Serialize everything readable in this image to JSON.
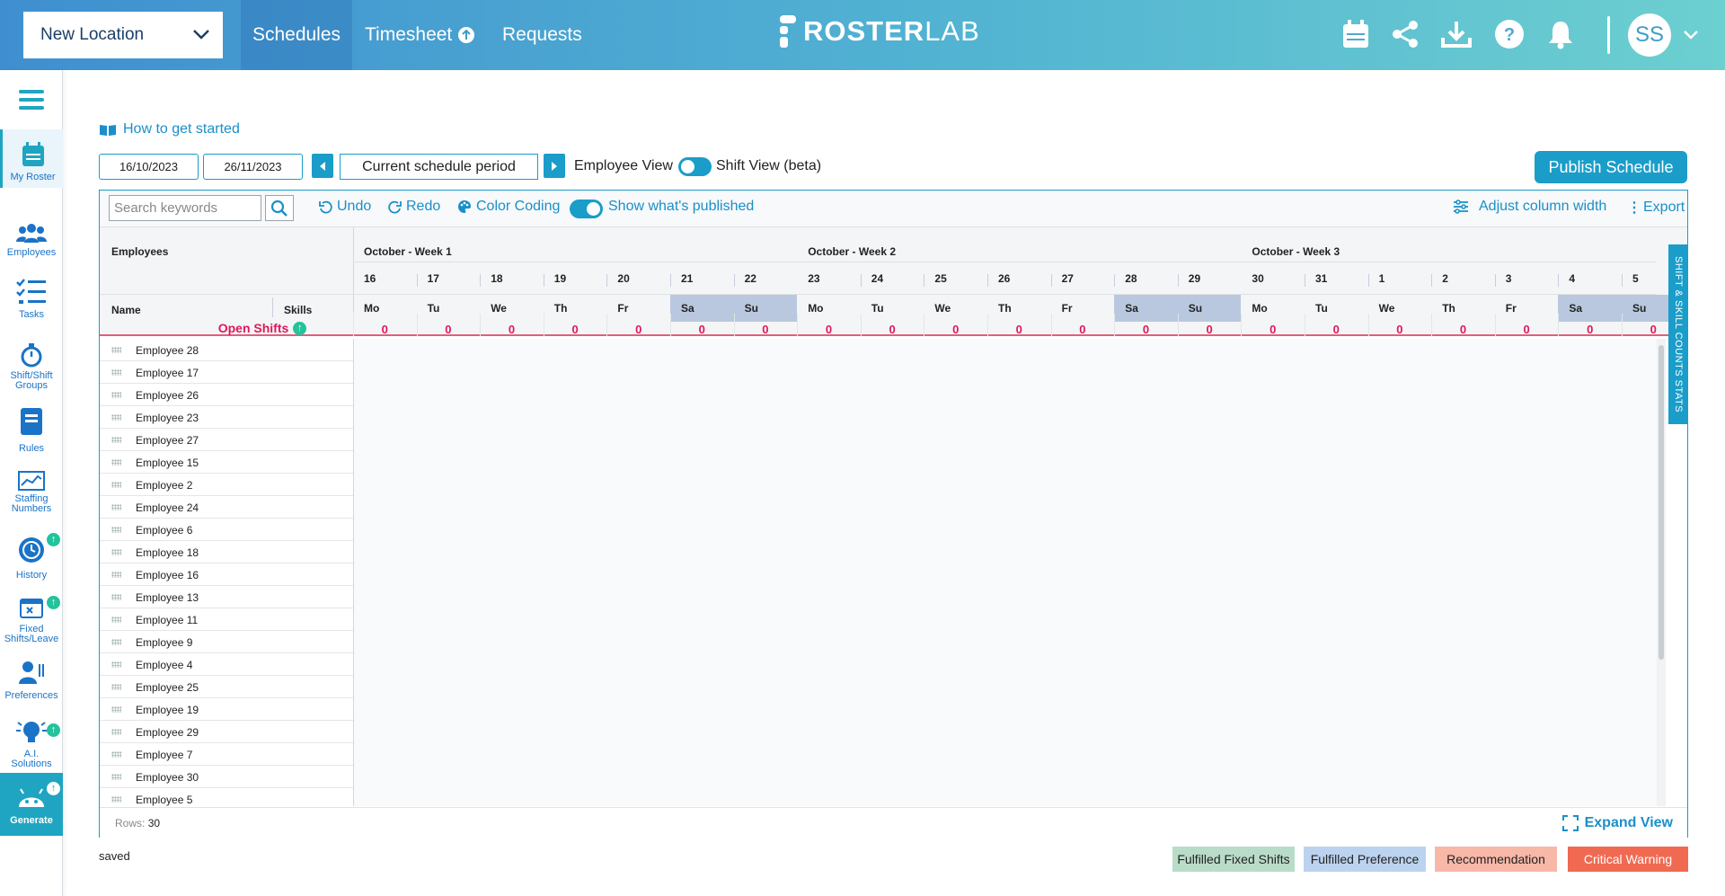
{
  "header": {
    "location": "New Location",
    "tabs": {
      "schedules": "Schedules",
      "timesheet": "Timesheet",
      "requests": "Requests"
    },
    "logo_bold": "ROSTER",
    "logo_light": "LAB",
    "icons": [
      "calendar-icon",
      "share-icon",
      "download-icon",
      "help-icon",
      "bell-icon"
    ],
    "avatar": "SS"
  },
  "sidebar": {
    "items": [
      {
        "label": "My Roster",
        "icon": "calendar-icon"
      },
      {
        "label": "Employees",
        "icon": "people-icon"
      },
      {
        "label": "Tasks",
        "icon": "tasks-icon"
      },
      {
        "label": "Shift/Shift Groups",
        "icon": "stopwatch-icon"
      },
      {
        "label": "Rules",
        "icon": "book-icon"
      },
      {
        "label": "Staffing Numbers",
        "icon": "chart-icon"
      },
      {
        "label": "History",
        "icon": "history-icon"
      },
      {
        "label": "Fixed Shifts/Leave",
        "icon": "calendar-x-icon"
      },
      {
        "label": "Preferences",
        "icon": "preferences-icon"
      },
      {
        "label": "A.I. Solutions",
        "icon": "lightbulb-icon"
      },
      {
        "label": "Generate",
        "icon": "robot-icon"
      }
    ]
  },
  "controls": {
    "how_to": "How to get started",
    "start_date": "16/10/2023",
    "end_date": "26/11/2023",
    "period": "Current schedule period",
    "employee_view": "Employee View",
    "shift_view": "Shift View (beta)",
    "publish": "Publish Schedule"
  },
  "toolbar": {
    "search_placeholder": "Search keywords",
    "undo": "Undo",
    "redo": "Redo",
    "color_coding": "Color Coding",
    "show_published": "Show what's published",
    "adjust": "Adjust column width",
    "export": "Export"
  },
  "grid": {
    "employees_header": "Employees",
    "name_header": "Name",
    "skills_header": "Skills",
    "open_shifts_label": "Open Shifts",
    "weeks": [
      "October - Week 1",
      "October - Week 2",
      "October - Week 3"
    ],
    "days": [
      {
        "d": "16",
        "w": "Mo"
      },
      {
        "d": "17",
        "w": "Tu"
      },
      {
        "d": "18",
        "w": "We"
      },
      {
        "d": "19",
        "w": "Th"
      },
      {
        "d": "20",
        "w": "Fr"
      },
      {
        "d": "21",
        "w": "Sa"
      },
      {
        "d": "22",
        "w": "Su"
      },
      {
        "d": "23",
        "w": "Mo"
      },
      {
        "d": "24",
        "w": "Tu"
      },
      {
        "d": "25",
        "w": "We"
      },
      {
        "d": "26",
        "w": "Th"
      },
      {
        "d": "27",
        "w": "Fr"
      },
      {
        "d": "28",
        "w": "Sa"
      },
      {
        "d": "29",
        "w": "Su"
      },
      {
        "d": "30",
        "w": "Mo"
      },
      {
        "d": "31",
        "w": "Tu"
      },
      {
        "d": "1",
        "w": "We"
      },
      {
        "d": "2",
        "w": "Th"
      },
      {
        "d": "3",
        "w": "Fr"
      },
      {
        "d": "4",
        "w": "Sa"
      },
      {
        "d": "5",
        "w": "Su"
      }
    ],
    "open_shift_counts": [
      "0",
      "0",
      "0",
      "0",
      "0",
      "0",
      "0",
      "0",
      "0",
      "0",
      "0",
      "0",
      "0",
      "0",
      "0",
      "0",
      "0",
      "0",
      "0",
      "0",
      "0"
    ],
    "employees": [
      "Employee 28",
      "Employee 17",
      "Employee 26",
      "Employee 23",
      "Employee 27",
      "Employee 15",
      "Employee 2",
      "Employee 24",
      "Employee 6",
      "Employee 18",
      "Employee 16",
      "Employee 13",
      "Employee 11",
      "Employee 9",
      "Employee 4",
      "Employee 25",
      "Employee 19",
      "Employee 29",
      "Employee 7",
      "Employee 30",
      "Employee 5"
    ],
    "side_panel": "SHIFT & SKILL COUNTS STATS",
    "rows_label": "Rows:",
    "rows_count": "30",
    "expand": "Expand View"
  },
  "status": "saved",
  "legend": [
    {
      "label": "Fulfilled Fixed Shifts",
      "color": "#b9dcc9"
    },
    {
      "label": "Fulfilled Preference",
      "color": "#bcd3ef"
    },
    {
      "label": "Recommendation",
      "color": "#f7b8a8"
    },
    {
      "label": "Critical Warning",
      "color": "#f06a52"
    }
  ],
  "colors": {
    "accent": "#1a9dc9",
    "weekend": "#b9c8de",
    "open_shift": "#e0185a"
  }
}
